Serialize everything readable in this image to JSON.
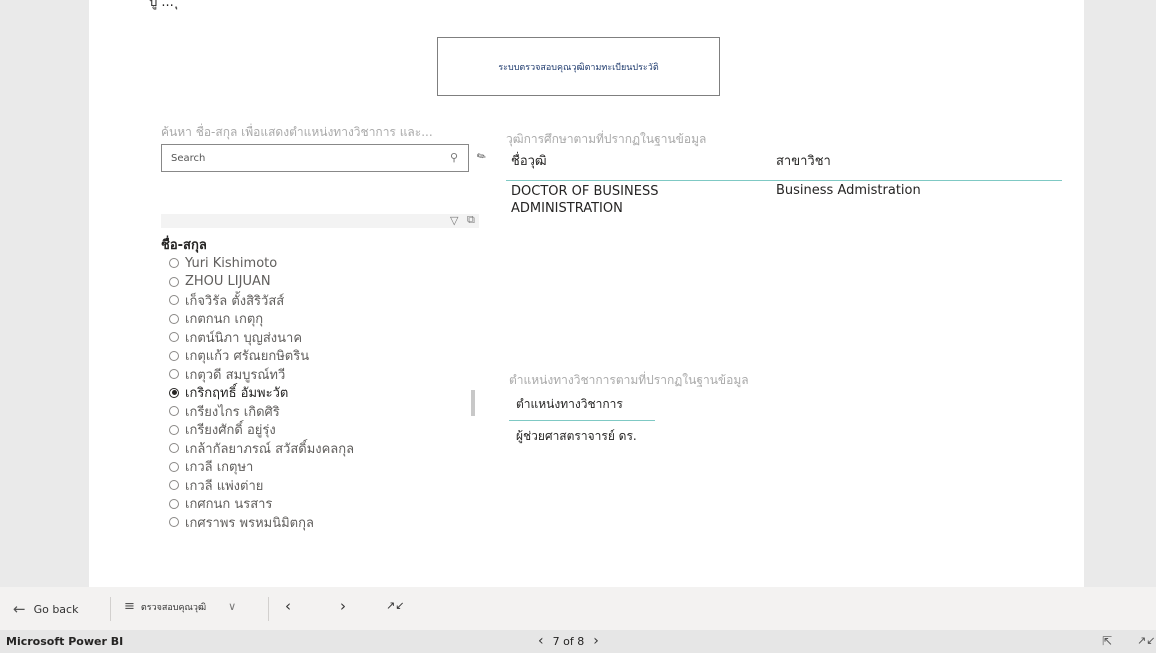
{
  "report": {
    "top_clip_text": "ปู้ ... ุ",
    "title": "ระบบตรวจสอบคุณวุฒิตามทะเบียนประวัติ"
  },
  "slicer": {
    "heading": "ค้นหา ชื่อ-สกุล เพื่อแสดงตำแหน่งทางวิชาการ และ...",
    "search_placeholder": "Search",
    "list_title": "ชื่อ-สกุล",
    "items": [
      {
        "label": "Yuri Kishimoto",
        "selected": false
      },
      {
        "label": "ZHOU LIJUAN",
        "selected": false
      },
      {
        "label": "เก็จวิรัล ตั้งสิริวัสส์",
        "selected": false
      },
      {
        "label": "เกตกนก เกตุกุ",
        "selected": false
      },
      {
        "label": "เกตน์นิภา บุญส่งนาค",
        "selected": false
      },
      {
        "label": "เกตุแก้ว ศรัณยกษิตริน",
        "selected": false
      },
      {
        "label": "เกตุวดี สมบูรณ์ทวี",
        "selected": false
      },
      {
        "label": "เกริกฤทธิ์ อัมพะวัต",
        "selected": true
      },
      {
        "label": "เกรียงไกร เกิดศิริ",
        "selected": false
      },
      {
        "label": "เกรียงศักดิ์ อยู่รุ่ง",
        "selected": false
      },
      {
        "label": "เกล้ากัลยาภรณ์ สวัสดิ์มงคลกุล",
        "selected": false
      },
      {
        "label": "เกวลี เกตุษา",
        "selected": false
      },
      {
        "label": "เกวลี แพ่งต่าย",
        "selected": false
      },
      {
        "label": "เกศกนก นรสาร",
        "selected": false
      },
      {
        "label": "เกศราพร พรหมนิมิตกุล",
        "selected": false
      }
    ]
  },
  "degree_table": {
    "title": "วุฒิการศึกษาตามที่ปรากฏในฐานข้อมูล",
    "columns": [
      "ชื่อวุฒิ",
      "สาขาวิชา"
    ],
    "rows": [
      {
        "degree": "DOCTOR OF BUSINESS ADMINISTRATION",
        "major": "Business Admistration"
      }
    ]
  },
  "position_table": {
    "title": "ตำแหน่งทางวิชาการตามที่ปรากฏในฐานข้อมูล",
    "column": "ตำแหน่งทางวิชาการ",
    "value": "ผู้ช่วยศาสตราจารย์ ดร."
  },
  "nav": {
    "back_label": "Go back",
    "page_name": "ตรวจสอบคุณวุฒิ"
  },
  "status": {
    "app_name": "Microsoft Power BI",
    "page_indicator": "7 of 8"
  }
}
